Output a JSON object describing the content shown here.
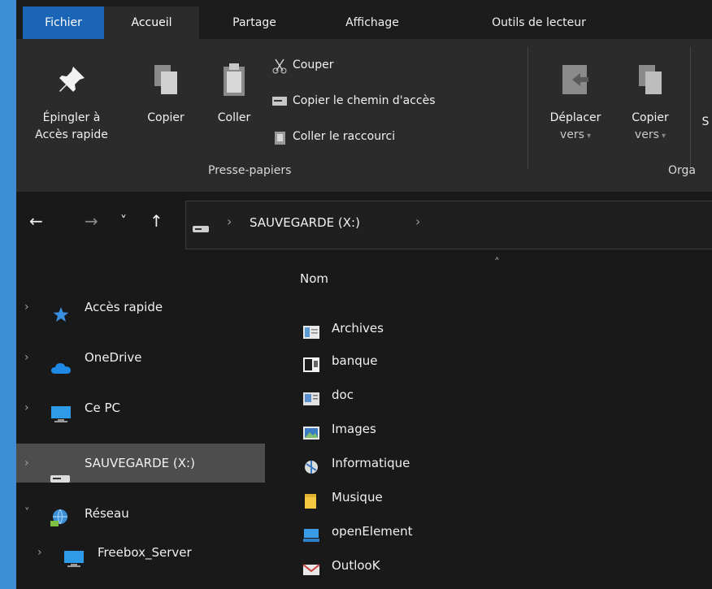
{
  "tabs": [
    {
      "label": "Fichier"
    },
    {
      "label": "Accueil"
    },
    {
      "label": "Partage"
    },
    {
      "label": "Affichage"
    },
    {
      "label": "Outils de lecteur"
    }
  ],
  "ribbon": {
    "pin_label_1": "Épingler à",
    "pin_label_2": "Accès rapide",
    "copy_label": "Copier",
    "paste_label": "Coller",
    "cut_label": "Couper",
    "copy_path_label": "Copier le chemin d'accès",
    "paste_shortcut_label": "Coller le raccourci",
    "clipboard_group": "Presse-papiers",
    "move_label_1": "Déplacer",
    "move_label_2": "vers",
    "copyto_label_1": "Copier",
    "copyto_label_2": "vers",
    "delete_label_partial": "S",
    "organize_group_partial": "Orga"
  },
  "nav": {
    "back": "←",
    "forward": "→",
    "recent": "˅",
    "up": "↑",
    "breadcrumb": "SAUVEGARDE (X:)",
    "separator": "›"
  },
  "sidebar": {
    "items": [
      {
        "label": "Accès rapide"
      },
      {
        "label": "OneDrive"
      },
      {
        "label": "Ce PC"
      },
      {
        "label": "SAUVEGARDE (X:)"
      },
      {
        "label": "Réseau"
      },
      {
        "label": "Freebox_Server"
      }
    ]
  },
  "content": {
    "column_name": "Nom",
    "files": [
      {
        "name": "Archives"
      },
      {
        "name": "banque"
      },
      {
        "name": "doc"
      },
      {
        "name": "Images"
      },
      {
        "name": "Informatique"
      },
      {
        "name": "Musique"
      },
      {
        "name": "openElement"
      },
      {
        "name": "OutlooK"
      }
    ]
  },
  "colors": {
    "background": "#3d8ed4",
    "window": "#191919",
    "ribbon": "#2b2b2b",
    "file_tab": "#1a65b5",
    "selected_item": "#4d4d4d"
  }
}
